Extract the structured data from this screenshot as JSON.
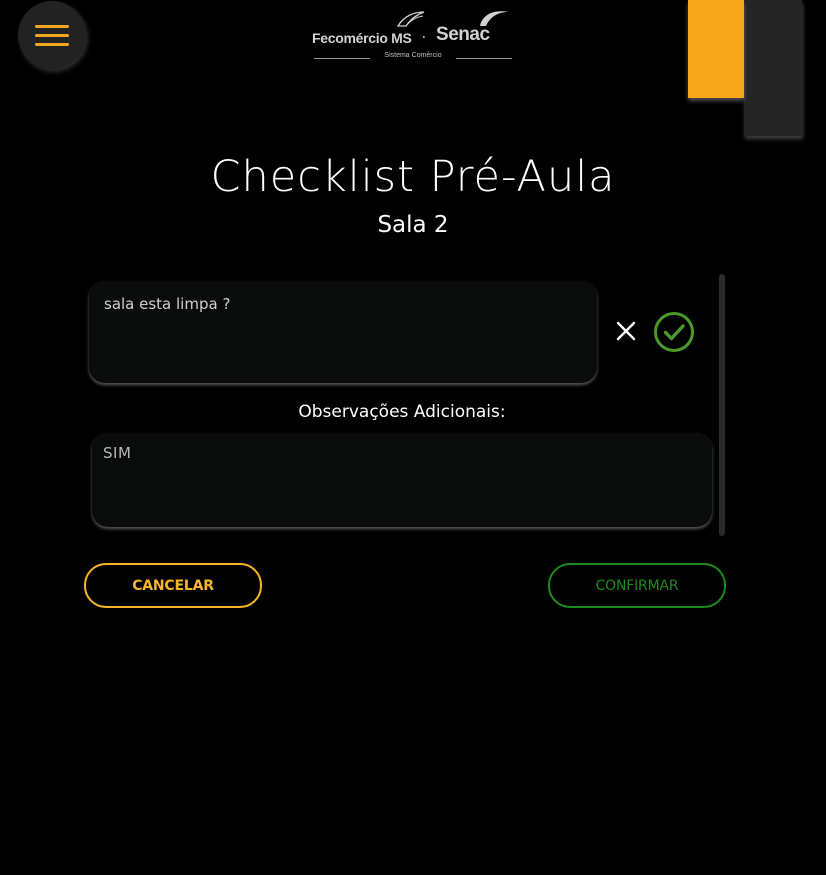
{
  "header": {
    "menu_icon": "hamburger-menu-icon",
    "logo": {
      "fecomercio": "Fecomércio MS",
      "separator": "·",
      "senac": "Senac",
      "tagline": "Sistema Comércio"
    }
  },
  "page": {
    "title": "Checklist Pré-Aula",
    "subtitle": "Sala 2"
  },
  "checklist": {
    "question": "sala esta limpa ?",
    "reject_icon": "close-x-icon",
    "accept_icon": "check-circle-icon",
    "observations_label": "Observações Adicionais:",
    "observations_value": "SIM"
  },
  "actions": {
    "cancel_label": "CANCELAR",
    "confirm_label": "CONFIRMAR"
  },
  "colors": {
    "accent_yellow": "#f7a61c",
    "confirm_green": "#1f8a1f",
    "check_green": "#4a9a2a",
    "background": "#000000"
  }
}
